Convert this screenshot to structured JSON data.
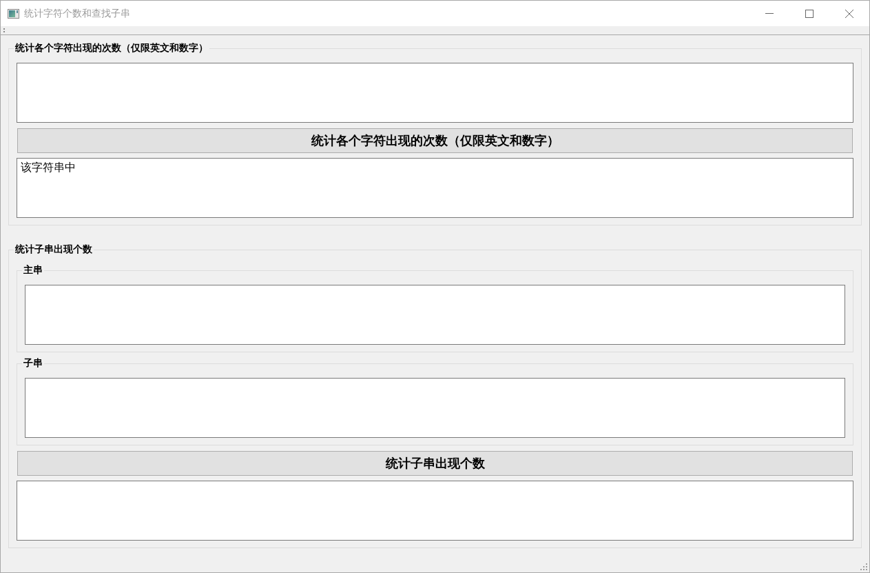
{
  "window": {
    "title": "统计字符个数和查找子串"
  },
  "groups": [
    {
      "title": "统计各个字符出现的次数（仅限英文和数字）",
      "items": [
        {
          "kind": "text_area"
        },
        {
          "kind": "button",
          "label": "统计各个字符出现的次数（仅限英文和数字）"
        },
        {
          "kind": "text_area",
          "value": "该字符串中"
        }
      ]
    },
    {
      "title": "统计子串出现个数",
      "items": [
        {
          "kind": "group",
          "title": "主串",
          "items": [
            {
              "kind": "text_area"
            }
          ]
        },
        {
          "kind": "group",
          "title": "子串",
          "items": [
            {
              "kind": "text_area"
            }
          ]
        },
        {
          "kind": "button",
          "label": "统计子串出现个数"
        },
        {
          "kind": "text_area"
        }
      ]
    }
  ]
}
